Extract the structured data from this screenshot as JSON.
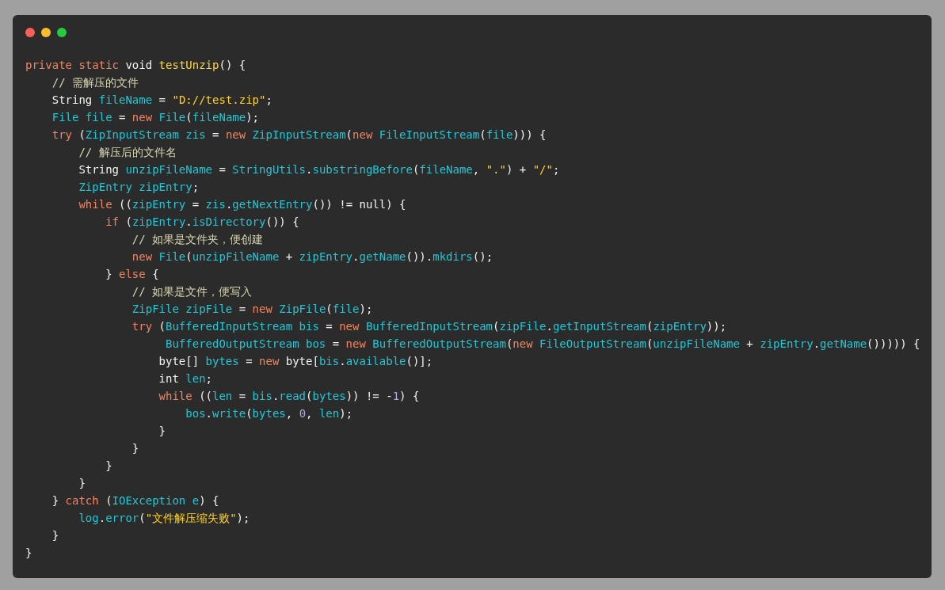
{
  "code_lines": [
    [
      {
        "kind": "keyword",
        "text": "private static "
      },
      {
        "kind": "type",
        "text": "void "
      },
      {
        "kind": "function",
        "text": "testUnzip"
      },
      {
        "kind": "plain",
        "text": "() {"
      }
    ],
    [
      {
        "kind": "comment",
        "text": "    // 需解压的文件"
      }
    ],
    [
      {
        "kind": "type",
        "text": "    String "
      },
      {
        "kind": "ident",
        "text": "fileName"
      },
      {
        "kind": "plain",
        "text": " = "
      },
      {
        "kind": "string",
        "text": "\"D://test.zip\""
      },
      {
        "kind": "plain",
        "text": ";"
      }
    ],
    [
      {
        "kind": "ident",
        "text": "    File file"
      },
      {
        "kind": "plain",
        "text": " = "
      },
      {
        "kind": "keyword",
        "text": "new "
      },
      {
        "kind": "ident",
        "text": "File"
      },
      {
        "kind": "plain",
        "text": "("
      },
      {
        "kind": "ident",
        "text": "fileName"
      },
      {
        "kind": "plain",
        "text": ");"
      }
    ],
    [
      {
        "kind": "keyword",
        "text": "    try "
      },
      {
        "kind": "plain",
        "text": "("
      },
      {
        "kind": "ident",
        "text": "ZipInputStream zis"
      },
      {
        "kind": "plain",
        "text": " = "
      },
      {
        "kind": "keyword",
        "text": "new "
      },
      {
        "kind": "ident",
        "text": "ZipInputStream"
      },
      {
        "kind": "plain",
        "text": "("
      },
      {
        "kind": "keyword",
        "text": "new "
      },
      {
        "kind": "ident",
        "text": "FileInputStream"
      },
      {
        "kind": "plain",
        "text": "("
      },
      {
        "kind": "ident",
        "text": "file"
      },
      {
        "kind": "plain",
        "text": "))) {"
      }
    ],
    [
      {
        "kind": "comment",
        "text": "        // 解压后的文件名"
      }
    ],
    [
      {
        "kind": "type",
        "text": "        String "
      },
      {
        "kind": "ident",
        "text": "unzipFileName"
      },
      {
        "kind": "plain",
        "text": " = "
      },
      {
        "kind": "ident",
        "text": "StringUtils"
      },
      {
        "kind": "plain",
        "text": "."
      },
      {
        "kind": "ident",
        "text": "substringBefore"
      },
      {
        "kind": "plain",
        "text": "("
      },
      {
        "kind": "ident",
        "text": "fileName"
      },
      {
        "kind": "plain",
        "text": ", "
      },
      {
        "kind": "string",
        "text": "\".\""
      },
      {
        "kind": "plain",
        "text": ") + "
      },
      {
        "kind": "string",
        "text": "\"/\""
      },
      {
        "kind": "plain",
        "text": ";"
      }
    ],
    [
      {
        "kind": "ident",
        "text": "        ZipEntry zipEntry"
      },
      {
        "kind": "plain",
        "text": ";"
      }
    ],
    [
      {
        "kind": "keyword",
        "text": "        while "
      },
      {
        "kind": "plain",
        "text": "(("
      },
      {
        "kind": "ident",
        "text": "zipEntry"
      },
      {
        "kind": "plain",
        "text": " = "
      },
      {
        "kind": "ident",
        "text": "zis"
      },
      {
        "kind": "plain",
        "text": "."
      },
      {
        "kind": "ident",
        "text": "getNextEntry"
      },
      {
        "kind": "plain",
        "text": "()) != null) {"
      }
    ],
    [
      {
        "kind": "keyword",
        "text": "            if "
      },
      {
        "kind": "plain",
        "text": "("
      },
      {
        "kind": "ident",
        "text": "zipEntry"
      },
      {
        "kind": "plain",
        "text": "."
      },
      {
        "kind": "ident",
        "text": "isDirectory"
      },
      {
        "kind": "plain",
        "text": "()) {"
      }
    ],
    [
      {
        "kind": "comment",
        "text": "                // 如果是文件夹，便创建"
      }
    ],
    [
      {
        "kind": "keyword",
        "text": "                new "
      },
      {
        "kind": "ident",
        "text": "File"
      },
      {
        "kind": "plain",
        "text": "("
      },
      {
        "kind": "ident",
        "text": "unzipFileName"
      },
      {
        "kind": "plain",
        "text": " + "
      },
      {
        "kind": "ident",
        "text": "zipEntry"
      },
      {
        "kind": "plain",
        "text": "."
      },
      {
        "kind": "ident",
        "text": "getName"
      },
      {
        "kind": "plain",
        "text": "())."
      },
      {
        "kind": "ident",
        "text": "mkdirs"
      },
      {
        "kind": "plain",
        "text": "();"
      }
    ],
    [
      {
        "kind": "plain",
        "text": "            } "
      },
      {
        "kind": "keyword",
        "text": "else"
      },
      {
        "kind": "plain",
        "text": " {"
      }
    ],
    [
      {
        "kind": "comment",
        "text": "                // 如果是文件，便写入"
      }
    ],
    [
      {
        "kind": "ident",
        "text": "                ZipFile zipFile"
      },
      {
        "kind": "plain",
        "text": " = "
      },
      {
        "kind": "keyword",
        "text": "new "
      },
      {
        "kind": "ident",
        "text": "ZipFile"
      },
      {
        "kind": "plain",
        "text": "("
      },
      {
        "kind": "ident",
        "text": "file"
      },
      {
        "kind": "plain",
        "text": ");"
      }
    ],
    [
      {
        "kind": "keyword",
        "text": "                try "
      },
      {
        "kind": "plain",
        "text": "("
      },
      {
        "kind": "ident",
        "text": "BufferedInputStream bis"
      },
      {
        "kind": "plain",
        "text": " = "
      },
      {
        "kind": "keyword",
        "text": "new "
      },
      {
        "kind": "ident",
        "text": "BufferedInputStream"
      },
      {
        "kind": "plain",
        "text": "("
      },
      {
        "kind": "ident",
        "text": "zipFile"
      },
      {
        "kind": "plain",
        "text": "."
      },
      {
        "kind": "ident",
        "text": "getInputStream"
      },
      {
        "kind": "plain",
        "text": "("
      },
      {
        "kind": "ident",
        "text": "zipEntry"
      },
      {
        "kind": "plain",
        "text": "));"
      }
    ],
    [
      {
        "kind": "ident",
        "text": "                     BufferedOutputStream bos"
      },
      {
        "kind": "plain",
        "text": " = "
      },
      {
        "kind": "keyword",
        "text": "new "
      },
      {
        "kind": "ident",
        "text": "BufferedOutputStream"
      },
      {
        "kind": "plain",
        "text": "("
      },
      {
        "kind": "keyword",
        "text": "new "
      },
      {
        "kind": "ident",
        "text": "FileOutputStream"
      },
      {
        "kind": "plain",
        "text": "("
      },
      {
        "kind": "ident",
        "text": "unzipFileName"
      },
      {
        "kind": "plain",
        "text": " + "
      },
      {
        "kind": "ident",
        "text": "zipEntry"
      },
      {
        "kind": "plain",
        "text": "."
      },
      {
        "kind": "ident",
        "text": "getName"
      },
      {
        "kind": "plain",
        "text": "())))) {"
      }
    ],
    [
      {
        "kind": "type",
        "text": "                    byte"
      },
      {
        "kind": "plain",
        "text": "[] "
      },
      {
        "kind": "ident",
        "text": "bytes"
      },
      {
        "kind": "plain",
        "text": " = "
      },
      {
        "kind": "keyword",
        "text": "new "
      },
      {
        "kind": "type",
        "text": "byte"
      },
      {
        "kind": "plain",
        "text": "["
      },
      {
        "kind": "ident",
        "text": "bis"
      },
      {
        "kind": "plain",
        "text": "."
      },
      {
        "kind": "ident",
        "text": "available"
      },
      {
        "kind": "plain",
        "text": "()];"
      }
    ],
    [
      {
        "kind": "type",
        "text": "                    int "
      },
      {
        "kind": "ident",
        "text": "len"
      },
      {
        "kind": "plain",
        "text": ";"
      }
    ],
    [
      {
        "kind": "keyword",
        "text": "                    while "
      },
      {
        "kind": "plain",
        "text": "(("
      },
      {
        "kind": "ident",
        "text": "len"
      },
      {
        "kind": "plain",
        "text": " = "
      },
      {
        "kind": "ident",
        "text": "bis"
      },
      {
        "kind": "plain",
        "text": "."
      },
      {
        "kind": "ident",
        "text": "read"
      },
      {
        "kind": "plain",
        "text": "("
      },
      {
        "kind": "ident",
        "text": "bytes"
      },
      {
        "kind": "plain",
        "text": ")) != -"
      },
      {
        "kind": "number",
        "text": "1"
      },
      {
        "kind": "plain",
        "text": ") {"
      }
    ],
    [
      {
        "kind": "ident",
        "text": "                        bos"
      },
      {
        "kind": "plain",
        "text": "."
      },
      {
        "kind": "ident",
        "text": "write"
      },
      {
        "kind": "plain",
        "text": "("
      },
      {
        "kind": "ident",
        "text": "bytes"
      },
      {
        "kind": "plain",
        "text": ", "
      },
      {
        "kind": "number",
        "text": "0"
      },
      {
        "kind": "plain",
        "text": ", "
      },
      {
        "kind": "ident",
        "text": "len"
      },
      {
        "kind": "plain",
        "text": ");"
      }
    ],
    [
      {
        "kind": "plain",
        "text": "                    }"
      }
    ],
    [
      {
        "kind": "plain",
        "text": "                }"
      }
    ],
    [
      {
        "kind": "plain",
        "text": "            }"
      }
    ],
    [
      {
        "kind": "plain",
        "text": "        }"
      }
    ],
    [
      {
        "kind": "plain",
        "text": "    } "
      },
      {
        "kind": "keyword",
        "text": "catch "
      },
      {
        "kind": "plain",
        "text": "("
      },
      {
        "kind": "ident",
        "text": "IOException e"
      },
      {
        "kind": "plain",
        "text": ") {"
      }
    ],
    [
      {
        "kind": "ident",
        "text": "        log"
      },
      {
        "kind": "plain",
        "text": "."
      },
      {
        "kind": "ident",
        "text": "error"
      },
      {
        "kind": "plain",
        "text": "("
      },
      {
        "kind": "string",
        "text": "\"文件解压缩失败\""
      },
      {
        "kind": "plain",
        "text": ");"
      }
    ],
    [
      {
        "kind": "plain",
        "text": "    }"
      }
    ],
    [
      {
        "kind": "plain",
        "text": "}"
      }
    ]
  ]
}
